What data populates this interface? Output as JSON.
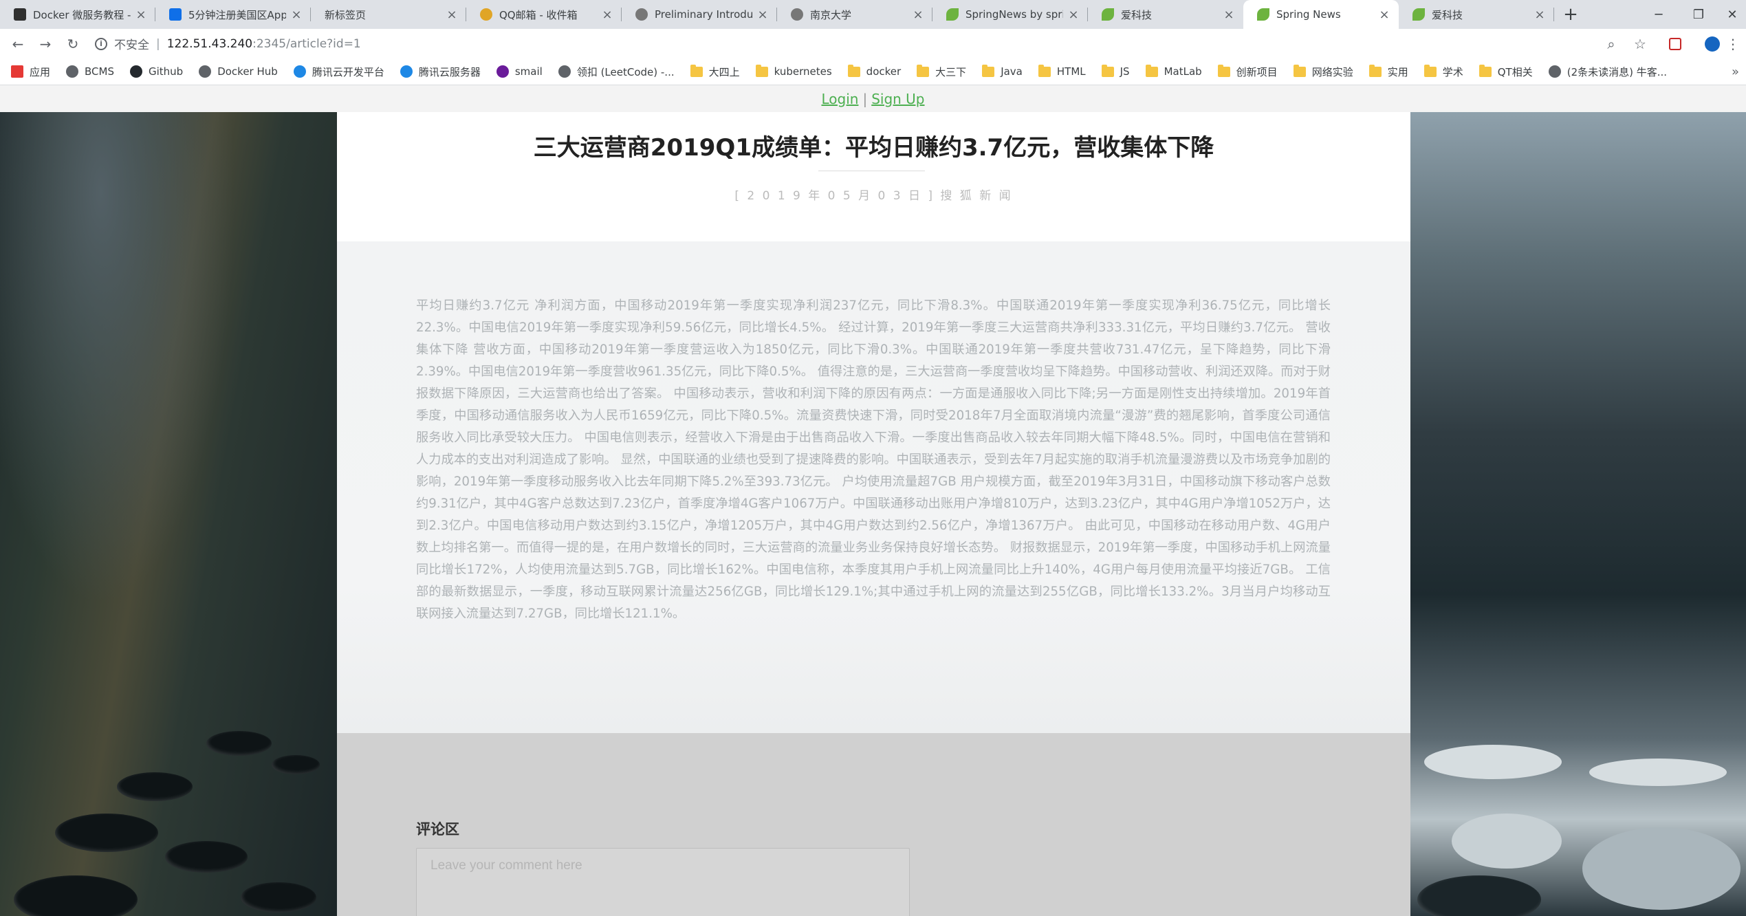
{
  "browser": {
    "tabs": [
      {
        "title": "Docker 微服务教程 - ",
        "icon": "docker-doc-icon",
        "color": "#2f2f2f"
      },
      {
        "title": "5分钟注册美国区App",
        "icon": "zhihu-icon",
        "color": "#0f6fe8"
      },
      {
        "title": "新标签页",
        "icon": "",
        "color": ""
      },
      {
        "title": "QQ邮箱 - 收件箱",
        "icon": "chrome-icon",
        "color": "#e0a526"
      },
      {
        "title": "Preliminary Introduc",
        "icon": "globe-icon",
        "color": "#777"
      },
      {
        "title": "南京大学",
        "icon": "globe-icon",
        "color": "#777"
      },
      {
        "title": "SpringNews by sprir",
        "icon": "spring-icon",
        "color": "#6db33f"
      },
      {
        "title": "爱科技",
        "icon": "spring-icon",
        "color": "#6db33f"
      },
      {
        "title": "Spring News",
        "icon": "spring-icon",
        "color": "#6db33f"
      },
      {
        "title": "爱科技",
        "icon": "spring-icon",
        "color": "#6db33f"
      }
    ],
    "active_tab": 8,
    "url": {
      "security": "不安全",
      "host": "122.51.43.240",
      "path": ":2345/article?id=1"
    },
    "bookmarks": [
      {
        "label": "应用",
        "type": "apps"
      },
      {
        "label": "BCMS",
        "type": "site"
      },
      {
        "label": "Github",
        "type": "github"
      },
      {
        "label": "Docker Hub",
        "type": "site"
      },
      {
        "label": "腾讯云开发平台",
        "type": "cloud"
      },
      {
        "label": "腾讯云服务器",
        "type": "cloud"
      },
      {
        "label": "smail",
        "type": "shield"
      },
      {
        "label": "领扣 (LeetCode) -...",
        "type": "site"
      },
      {
        "label": "大四上",
        "type": "folder"
      },
      {
        "label": "kubernetes",
        "type": "folder"
      },
      {
        "label": "docker",
        "type": "folder"
      },
      {
        "label": "大三下",
        "type": "folder"
      },
      {
        "label": "Java",
        "type": "folder"
      },
      {
        "label": "HTML",
        "type": "folder"
      },
      {
        "label": "JS",
        "type": "folder"
      },
      {
        "label": "MatLab",
        "type": "folder"
      },
      {
        "label": "创新项目",
        "type": "folder"
      },
      {
        "label": "网络实验",
        "type": "folder"
      },
      {
        "label": "实用",
        "type": "folder"
      },
      {
        "label": "学术",
        "type": "folder"
      },
      {
        "label": "QT相关",
        "type": "folder"
      },
      {
        "label": "(2条未读消息) 牛客...",
        "type": "site"
      }
    ],
    "more": "»"
  },
  "auth": {
    "login": "Login",
    "separator": "|",
    "signup": "Sign Up"
  },
  "article": {
    "title": "三大运营商2019Q1成绩单：平均日赚约3.7亿元，营收集体下降",
    "meta": "[ 2 0 1 9 年 0 5 月 0 3 日 ] 搜 狐 新 闻",
    "body": "平均日赚约3.7亿元 净利润方面，中国移动2019年第一季度实现净利润237亿元，同比下滑8.3%。中国联通2019年第一季度实现净利36.75亿元，同比增长22.3%。中国电信2019年第一季度实现净利59.56亿元，同比增长4.5%。 经过计算，2019年第一季度三大运营商共净利333.31亿元，平均日赚约3.7亿元。 营收集体下降 营收方面，中国移动2019年第一季度营运收入为1850亿元，同比下滑0.3%。中国联通2019年第一季度共营收731.47亿元，呈下降趋势，同比下滑2.39%。中国电信2019年第一季度营收961.35亿元，同比下降0.5%。 值得注意的是，三大运营商一季度营收均呈下降趋势。中国移动营收、利润还双降。而对于财报数据下降原因，三大运营商也给出了答案。 中国移动表示，营收和利润下降的原因有两点：一方面是通服收入同比下降;另一方面是刚性支出持续增加。2019年首季度，中国移动通信服务收入为人民币1659亿元，同比下降0.5%。流量资费快速下滑，同时受2018年7月全面取消境内流量“漫游”费的翘尾影响，首季度公司通信服务收入同比承受较大压力。 中国电信则表示，经营收入下滑是由于出售商品收入下滑。一季度出售商品收入较去年同期大幅下降48.5%。同时，中国电信在营销和人力成本的支出对利润造成了影响。 显然，中国联通的业绩也受到了提速降费的影响。中国联通表示，受到去年7月起实施的取消手机流量漫游费以及市场竞争加剧的影响，2019年第一季度移动服务收入比去年同期下降5.2%至393.73亿元。 户均使用流量超7GB 用户规模方面，截至2019年3月31日，中国移动旗下移动客户总数约9.31亿户，其中4G客户总数达到7.23亿户，首季度净增4G客户1067万户。中国联通移动出账用户净增810万户，达到3.23亿户，其中4G用户净增1052万户，达到2.3亿户。中国电信移动用户数达到约3.15亿户，净增1205万户，其中4G用户数达到约2.56亿户，净增1367万户。 由此可见，中国移动在移动用户数、4G用户数上均排名第一。而值得一提的是，在用户数增长的同时，三大运营商的流量业务业务保持良好增长态势。 财报数据显示，2019年第一季度，中国移动手机上网流量同比增长172%，人均使用流量达到5.7GB，同比增长162%。中国电信称，本季度其用户手机上网流量同比上升140%，4G用户每月使用流量平均接近7GB。 工信部的最新数据显示，一季度，移动互联网累计流量达256亿GB，同比增长129.1%;其中通过手机上网的流量达到255亿GB，同比增长133.2%。3月当月户均移动互联网接入流量达到7.27GB，同比增长121.1%。"
  },
  "comments": {
    "title": "评论区",
    "placeholder": "Leave your comment here"
  }
}
